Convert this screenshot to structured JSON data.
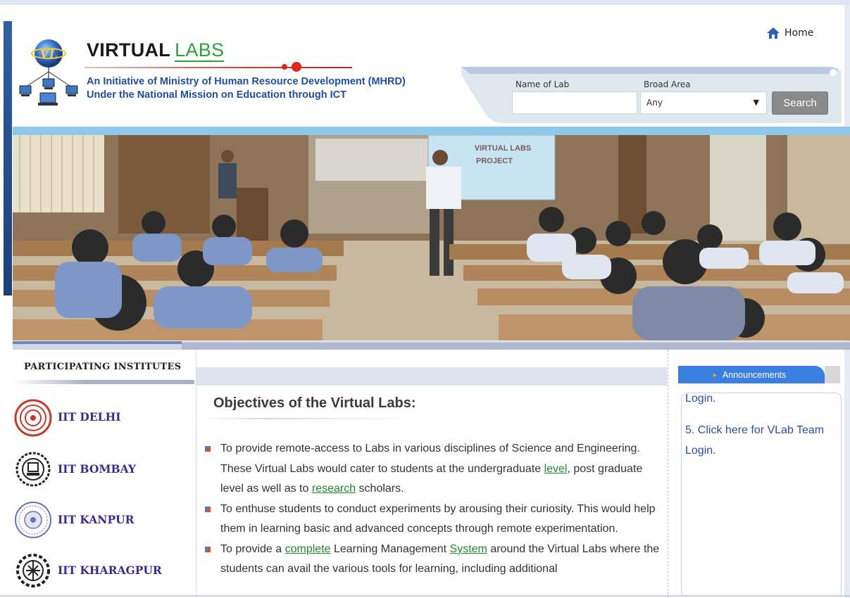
{
  "header": {
    "brand_main": "VIRTUAL",
    "brand_accent": "LABS",
    "tagline_line1": "An Initiative of Ministry of Human Resource Development (MHRD)",
    "tagline_line2": "Under the National Mission on Education through ICT",
    "logo_text": "VL",
    "home_label": "Home"
  },
  "search": {
    "lab_label": "Name of Lab",
    "lab_value": "",
    "area_label": "Broad Area",
    "area_selected": "Any",
    "button_label": "Search"
  },
  "banner": {
    "screen_text_line1": "VIRTUAL LABS",
    "screen_text_line2": "PROJECT"
  },
  "sidebar": {
    "heading": "PARTICIPATING INSTITUTES",
    "institutes": [
      {
        "name": "IIT DELHI"
      },
      {
        "name": "IIT BOMBAY"
      },
      {
        "name": "IIT KANPUR"
      },
      {
        "name": "IIT KHARAGPUR"
      }
    ]
  },
  "main": {
    "title": "Objectives of the Virtual Labs:",
    "bullets": [
      {
        "p1": "To provide remote-access to Labs in various disciplines of Science and Engineering. These Virtual Labs would cater to students at the undergraduate ",
        "link1": "level",
        "p2": ", post graduate level as well as to ",
        "link2": "research",
        "p3": " scholars."
      },
      {
        "p1": "To enthuse students to conduct experiments by arousing their curiosity. This would help them in learning basic and advanced concepts through remote experimentation."
      },
      {
        "p1": "To provide a ",
        "link1": "complete",
        "p2": " Learning Management ",
        "link2": "System",
        "p3": " around the Virtual Labs where the students can avail the various tools for learning, including additional"
      }
    ]
  },
  "announcements": {
    "tab_label": "Announcements",
    "partial_text": "Login.",
    "item5": "5. Click here for VLab Team Login."
  },
  "colors": {
    "brand_blue": "#1f4f9c",
    "brand_green": "#2e9f3a",
    "institute_purple": "#3c2a8c",
    "announcement_tab": "#3a7fe0"
  }
}
